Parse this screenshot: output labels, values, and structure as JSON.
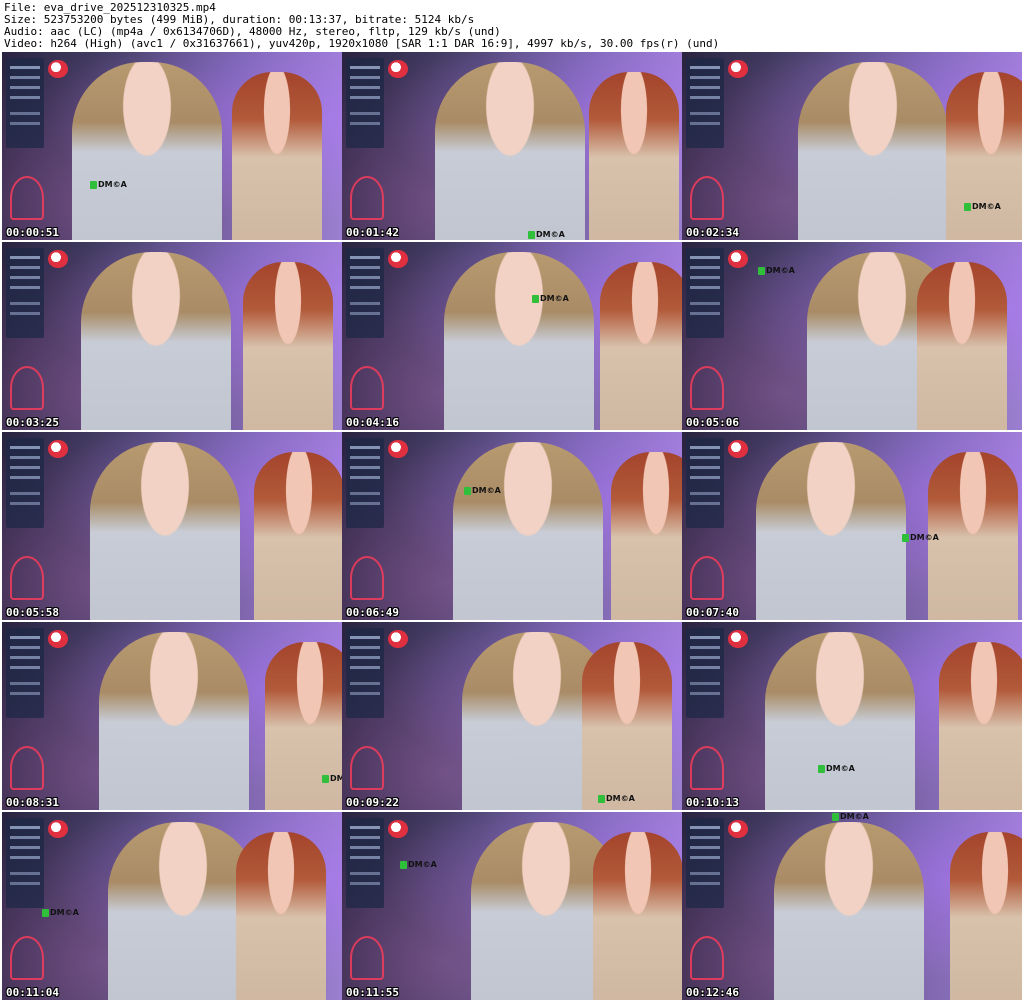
{
  "header": {
    "line1": "File: eva_drive_202512310325.mp4",
    "line2": "Size: 523753200 bytes (499 MiB), duration: 00:13:37, bitrate: 5124 kb/s",
    "line3": "Audio: aac (LC) (mp4a / 0x6134706D), 48000 Hz, stereo, fltp, 129 kb/s (und)",
    "line4": "Video: h264 (High) (avc1 / 0x31637661), yuv420p, 1920x1080 [SAR 1:1 DAR 16:9], 4997 kb/s, 30.00 fps(r) (und)"
  },
  "frames": [
    {
      "time": "00:00:51",
      "watermark": "DM©A"
    },
    {
      "time": "00:01:42",
      "watermark": "DM©A"
    },
    {
      "time": "00:02:34",
      "watermark": "DM©A"
    },
    {
      "time": "00:03:25",
      "watermark": ""
    },
    {
      "time": "00:04:16",
      "watermark": "DM©A"
    },
    {
      "time": "00:05:06",
      "watermark": "DM©A"
    },
    {
      "time": "00:05:58",
      "watermark": ""
    },
    {
      "time": "00:06:49",
      "watermark": "DM©A"
    },
    {
      "time": "00:07:40",
      "watermark": "DM©A"
    },
    {
      "time": "00:08:31",
      "watermark": "DM©A"
    },
    {
      "time": "00:09:22",
      "watermark": "DM©A"
    },
    {
      "time": "00:10:13",
      "watermark": "DM©A"
    },
    {
      "time": "00:11:04",
      "watermark": "DM©A"
    },
    {
      "time": "00:11:55",
      "watermark": "DM©A"
    },
    {
      "time": "00:12:46",
      "watermark": "DM©A"
    }
  ]
}
